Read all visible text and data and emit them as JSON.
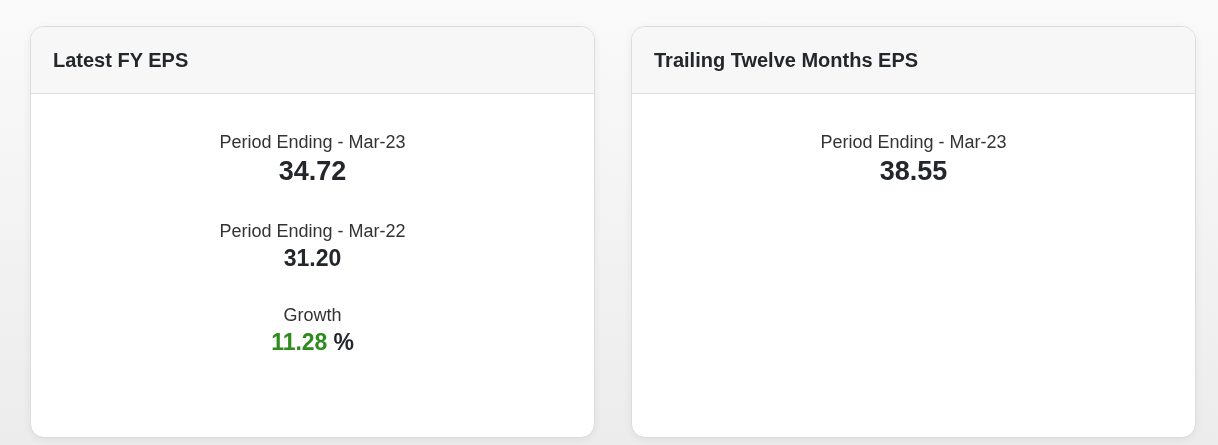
{
  "cards": [
    {
      "title": "Latest FY EPS",
      "stats": [
        {
          "kind": "primary",
          "label": "Period Ending - Mar-23",
          "value": "34.72"
        },
        {
          "kind": "secondary",
          "label": "Period Ending - Mar-22",
          "value": "31.20"
        },
        {
          "kind": "growth",
          "label": "Growth",
          "value": "11.28",
          "unit": "%",
          "positive": true
        }
      ]
    },
    {
      "title": "Trailing Twelve Months EPS",
      "stats": [
        {
          "kind": "primary",
          "label": "Period Ending - Mar-23",
          "value": "38.55"
        }
      ]
    }
  ]
}
